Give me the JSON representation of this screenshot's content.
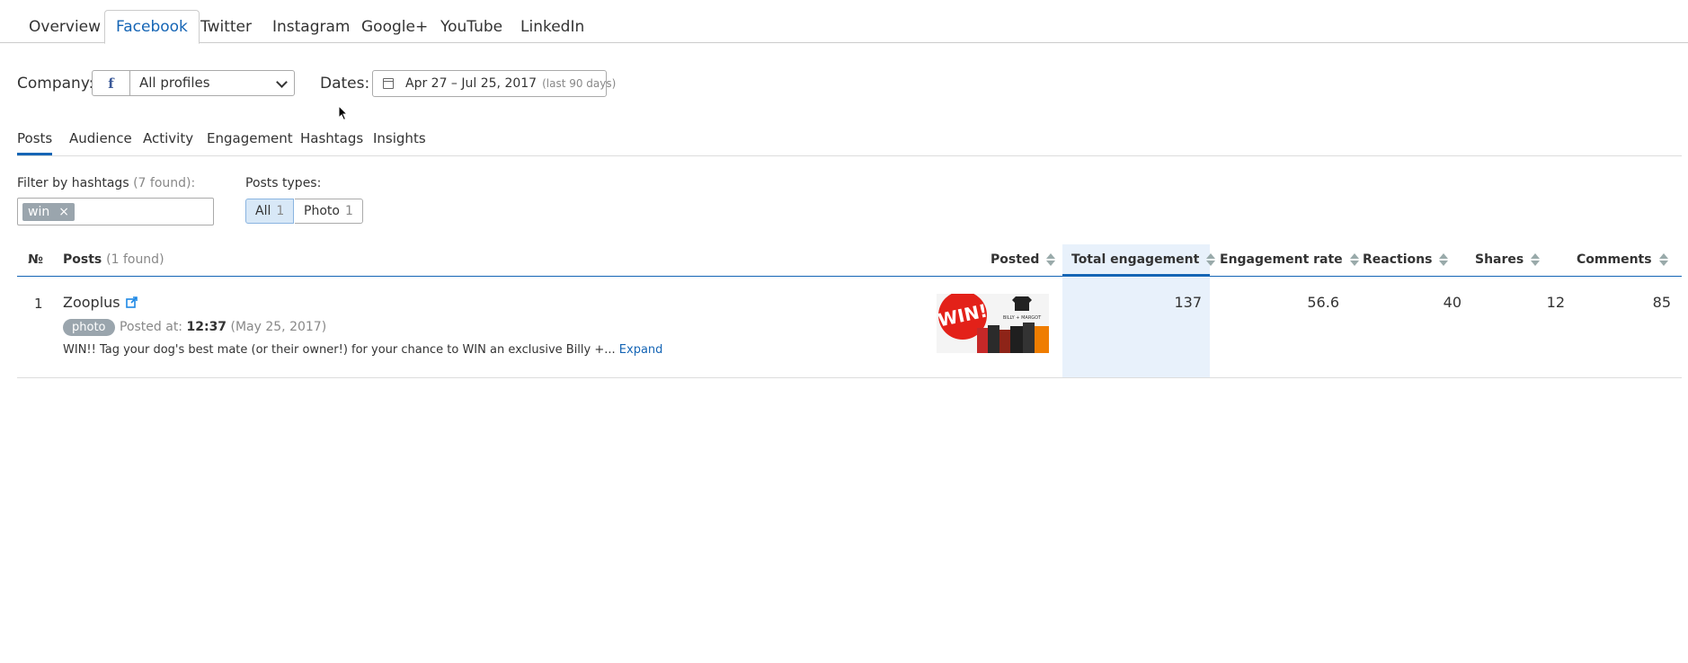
{
  "top_tabs": [
    {
      "label": "Overview"
    },
    {
      "label": "Facebook"
    },
    {
      "label": "Twitter"
    },
    {
      "label": "Instagram"
    },
    {
      "label": "Google+"
    },
    {
      "label": "YouTube"
    },
    {
      "label": "LinkedIn"
    }
  ],
  "active_top_tab": "Facebook",
  "filters": {
    "company_label": "Company:",
    "fb_glyph": "f",
    "profile_value": "All profiles",
    "dates_label": "Dates:",
    "date_range": "Apr 27 – Jul 25, 2017",
    "date_note": "(last 90 days)"
  },
  "sub_tabs": [
    {
      "label": "Posts"
    },
    {
      "label": "Audience"
    },
    {
      "label": "Activity"
    },
    {
      "label": "Engagement"
    },
    {
      "label": "Hashtags"
    },
    {
      "label": "Insights"
    }
  ],
  "active_sub_tab": "Posts",
  "hashtag_filter": {
    "label": "Filter by hashtags",
    "found": "(7 found):",
    "tags": [
      {
        "text": "win",
        "remove": "×"
      }
    ]
  },
  "post_types": {
    "label": "Posts types:",
    "options": [
      {
        "label": "All",
        "count": "1"
      },
      {
        "label": "Photo",
        "count": "1"
      }
    ]
  },
  "table": {
    "headers": {
      "no": "№",
      "posts": "Posts",
      "posts_found": "(1 found)",
      "posted": "Posted",
      "total_engagement": "Total engagement",
      "engagement_rate": "Engagement rate",
      "reactions": "Reactions",
      "shares": "Shares",
      "comments": "Comments"
    },
    "rows": [
      {
        "no": "1",
        "name": "Zooplus",
        "type": "photo",
        "posted_prefix": "Posted at:",
        "time": "12:37",
        "date": "(May 25, 2017)",
        "text": "WIN!! Tag your dog's best mate (or their owner!) for your chance to WIN an exclusive Billy +...",
        "expand": "Expand",
        "image_text": "WIN!",
        "image_brand": "BILLY + MARGOT",
        "total_engagement": "137",
        "engagement_rate": "56.6",
        "reactions": "40",
        "shares": "12",
        "comments": "85"
      }
    ]
  },
  "colors": {
    "accent": "#1565b5",
    "highlight": "#e8f1fb",
    "badge": "#9aa5ad",
    "facebook": "#3b5998"
  }
}
